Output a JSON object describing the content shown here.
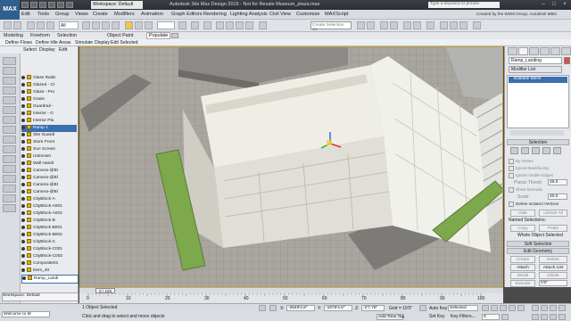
{
  "app": {
    "logo": "MAX",
    "workspace": "Workspace: Default",
    "title": "Autodesk 3ds Max Design 2015 - Not for Resale   Museum_plaza.max",
    "search_placeholder": "Type a keyword or phrase"
  },
  "menu": {
    "items": [
      "Edit",
      "Tools",
      "Group",
      "Views",
      "Create",
      "Modifiers",
      "Animation",
      "Graph Editors",
      "Rendering",
      "Lighting Analysis",
      "Civil View",
      "Customize",
      "MAXScript"
    ],
    "credit": "Created by the WDM Group, Autodesk MBG"
  },
  "toolbar": {
    "view_mode": "All",
    "selection_set_placeholder": "Create Selection Se"
  },
  "ribbon": {
    "tabs": [
      "Modeling",
      "Freeform",
      "Selection",
      "Object Paint",
      "Populate"
    ],
    "subtabs": [
      "Define Flows",
      "Define Idle Areas",
      "Simulate",
      "Display",
      "Edit Selected"
    ]
  },
  "explorer": {
    "header": [
      "Select",
      "Display",
      "Edit"
    ],
    "rows": [
      "Glass Railin",
      "Glazed - Cl",
      "Glass - Pro",
      "Grass",
      "Guardrail - ",
      "Interior - G",
      "Interior Pla",
      "Ramp 1",
      "Site Guardr",
      "Store Front",
      "Sun Screen",
      "Unknown",
      "Wall Handr",
      "Camera-@Bl",
      "Camera-@Bl",
      "Camera-@Bl",
      "Camera-@Bl",
      "CityBlock-A",
      "CityBlock-A001",
      "CityBlock-A002",
      "CityBlock-B",
      "CityBlock-B001",
      "CityBlock-B002",
      "CityBlock-C",
      "CityBlock-C001",
      "CityBlock-C002",
      "Composite01",
      "Dem_40",
      "Ramp_Landi"
    ],
    "footer": "Workspace: Default"
  },
  "command_panel": {
    "object_name": "Ramp_Landing",
    "modifier_list": "Modifier List",
    "stack_item": "Editable Mesh",
    "selection_section": "Selection",
    "by_vertex": "By Vertex",
    "ignore_backfacing": "Ignore Backfacing",
    "ignore_visible_edges": "Ignore Visible Edges",
    "planar_thresh": "Planar Thresh",
    "planar_thresh_value": "45.0",
    "show_normals": "Show Normals",
    "scale_label": "Scale:",
    "scale_value": "20.0",
    "delete_isolated": "Delete Isolated Vertices",
    "hide_button": "Hide",
    "unhide_all_button": "Unhide All",
    "named_selections": "Named Selections:",
    "copy_button": "Copy",
    "paste_button": "Paste",
    "whole_object": "Whole Object Selected",
    "soft_selection": "Soft Selection",
    "edit_geometry": "Edit Geometry",
    "create_button": "Create",
    "delete_button": "Delete",
    "attach_button": "Attach",
    "attach_list_button": "Attach List",
    "break_button": "Break",
    "divide_button": "Divide",
    "extrude_button": "Extrude",
    "extrude_value": "0'0\"",
    "bevel_button": "Bevel"
  },
  "timeline": {
    "frame": "0 / 100",
    "ticks": [
      "0",
      "10",
      "20",
      "30",
      "40",
      "50",
      "60",
      "70",
      "80",
      "90",
      "100"
    ]
  },
  "status": {
    "welcome": "Welcome to M",
    "objects_selected": "1 Object Selected",
    "prompt": "Click and drag to select and move objects",
    "x_label": "X:",
    "x": "-2649'4.8\"",
    "y_label": "Y:",
    "y": "-1679'4.8\"",
    "z_label": "Z:",
    "z": "-2'7.78\"",
    "grid": "Grid = 10'0\"",
    "auto_key": "Auto Key",
    "auto_key_mode": "Selected",
    "set_key": "Set Key",
    "key_filters": "Key Filters...",
    "add_time_tag": "Add Time Tag",
    "frame_field": "0"
  }
}
